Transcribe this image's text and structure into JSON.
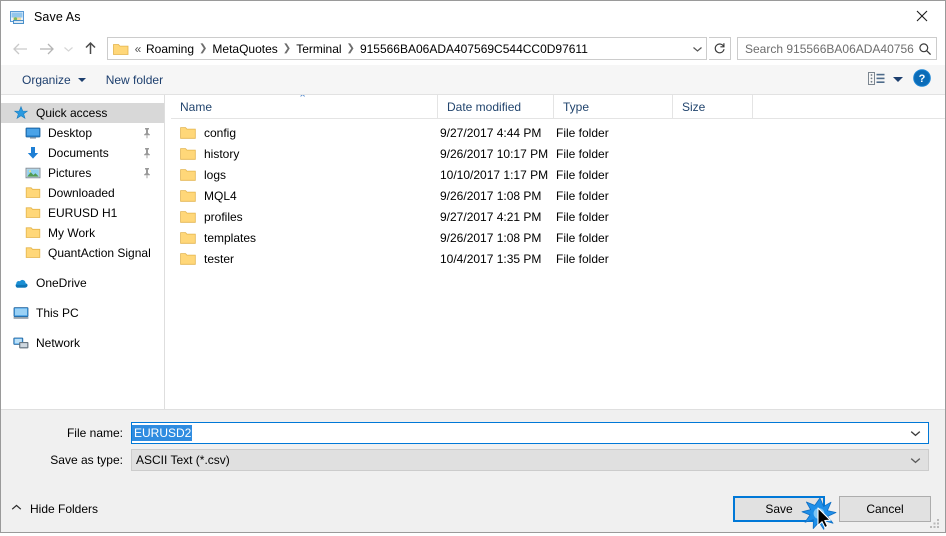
{
  "window": {
    "title": "Save As",
    "title_icon": "save-as-app-icon",
    "close_label": "✕"
  },
  "nav": {
    "back_icon": "back-arrow-icon",
    "forward_icon": "forward-arrow-icon",
    "recent_icon": "recent-locations-chevron-icon",
    "up_icon": "up-arrow-icon",
    "address_folder_icon": "folder-icon",
    "overflow_chevron": "«",
    "breadcrumbs": [
      "Roaming",
      "MetaQuotes",
      "Terminal",
      "915566BA06ADA407569C544CC0D97611"
    ],
    "separator": "❯",
    "dropdown_icon": "chevron-down-icon",
    "refresh_icon": "refresh-icon"
  },
  "search": {
    "placeholder": "Search 915566BA06ADA40756...",
    "icon": "search-icon"
  },
  "toolbar": {
    "organize_label": "Organize",
    "new_folder_label": "New folder",
    "view_icon": "view-layout-icon",
    "help_icon": "help-icon",
    "help_label": "?"
  },
  "sidebar": {
    "items": [
      {
        "label": "Quick access",
        "icon": "star-icon",
        "selected": true,
        "indent": 0,
        "pinned": false,
        "group": false
      },
      {
        "label": "Desktop",
        "icon": "desktop-icon",
        "selected": false,
        "indent": 1,
        "pinned": true,
        "group": false
      },
      {
        "label": "Documents",
        "icon": "documents-icon",
        "selected": false,
        "indent": 1,
        "pinned": true,
        "group": false
      },
      {
        "label": "Pictures",
        "icon": "pictures-icon",
        "selected": false,
        "indent": 1,
        "pinned": true,
        "group": false
      },
      {
        "label": "Downloaded",
        "icon": "folder-icon",
        "selected": false,
        "indent": 1,
        "pinned": false,
        "group": false
      },
      {
        "label": "EURUSD H1",
        "icon": "folder-icon",
        "selected": false,
        "indent": 1,
        "pinned": false,
        "group": false
      },
      {
        "label": "My Work",
        "icon": "folder-icon",
        "selected": false,
        "indent": 1,
        "pinned": false,
        "group": false
      },
      {
        "label": "QuantAction Signal",
        "icon": "folder-icon",
        "selected": false,
        "indent": 1,
        "pinned": false,
        "group": false
      },
      {
        "label": "OneDrive",
        "icon": "onedrive-icon",
        "selected": false,
        "indent": 0,
        "pinned": false,
        "group": true
      },
      {
        "label": "This PC",
        "icon": "this-pc-icon",
        "selected": false,
        "indent": 0,
        "pinned": false,
        "group": true
      },
      {
        "label": "Network",
        "icon": "network-icon",
        "selected": false,
        "indent": 0,
        "pinned": false,
        "group": true
      }
    ]
  },
  "filelist": {
    "columns": [
      "Name",
      "Date modified",
      "Type",
      "Size"
    ],
    "sort_column": "Name",
    "sort_indicator": "⌃",
    "rows": [
      {
        "name": "config",
        "date": "9/27/2017 4:44 PM",
        "type": "File folder",
        "size": ""
      },
      {
        "name": "history",
        "date": "9/26/2017 10:17 PM",
        "type": "File folder",
        "size": ""
      },
      {
        "name": "logs",
        "date": "10/10/2017 1:17 PM",
        "type": "File folder",
        "size": ""
      },
      {
        "name": "MQL4",
        "date": "9/26/2017 1:08 PM",
        "type": "File folder",
        "size": ""
      },
      {
        "name": "profiles",
        "date": "9/27/2017 4:21 PM",
        "type": "File folder",
        "size": ""
      },
      {
        "name": "templates",
        "date": "9/26/2017 1:08 PM",
        "type": "File folder",
        "size": ""
      },
      {
        "name": "tester",
        "date": "10/4/2017 1:35 PM",
        "type": "File folder",
        "size": ""
      }
    ]
  },
  "form": {
    "filename_label": "File name:",
    "filename_value": "EURUSD2",
    "filetype_label": "Save as type:",
    "filetype_value": "ASCII Text (*.csv)",
    "dropdown_icon": "chevron-down-icon"
  },
  "footer": {
    "hide_folders_label": "Hide Folders",
    "hide_folders_icon": "chevron-up-icon",
    "save_label": "Save",
    "cancel_label": "Cancel",
    "resize_grip_icon": "resize-grip-icon",
    "cursor_icon": "mouse-pointer-click-icon"
  },
  "colors": {
    "accent": "#0078d7",
    "selection": "#2f8ce0",
    "folder_yellow": "#ffd779",
    "link_blue": "#1d3f6e",
    "sidebar_selected": "#d8d8d8"
  }
}
